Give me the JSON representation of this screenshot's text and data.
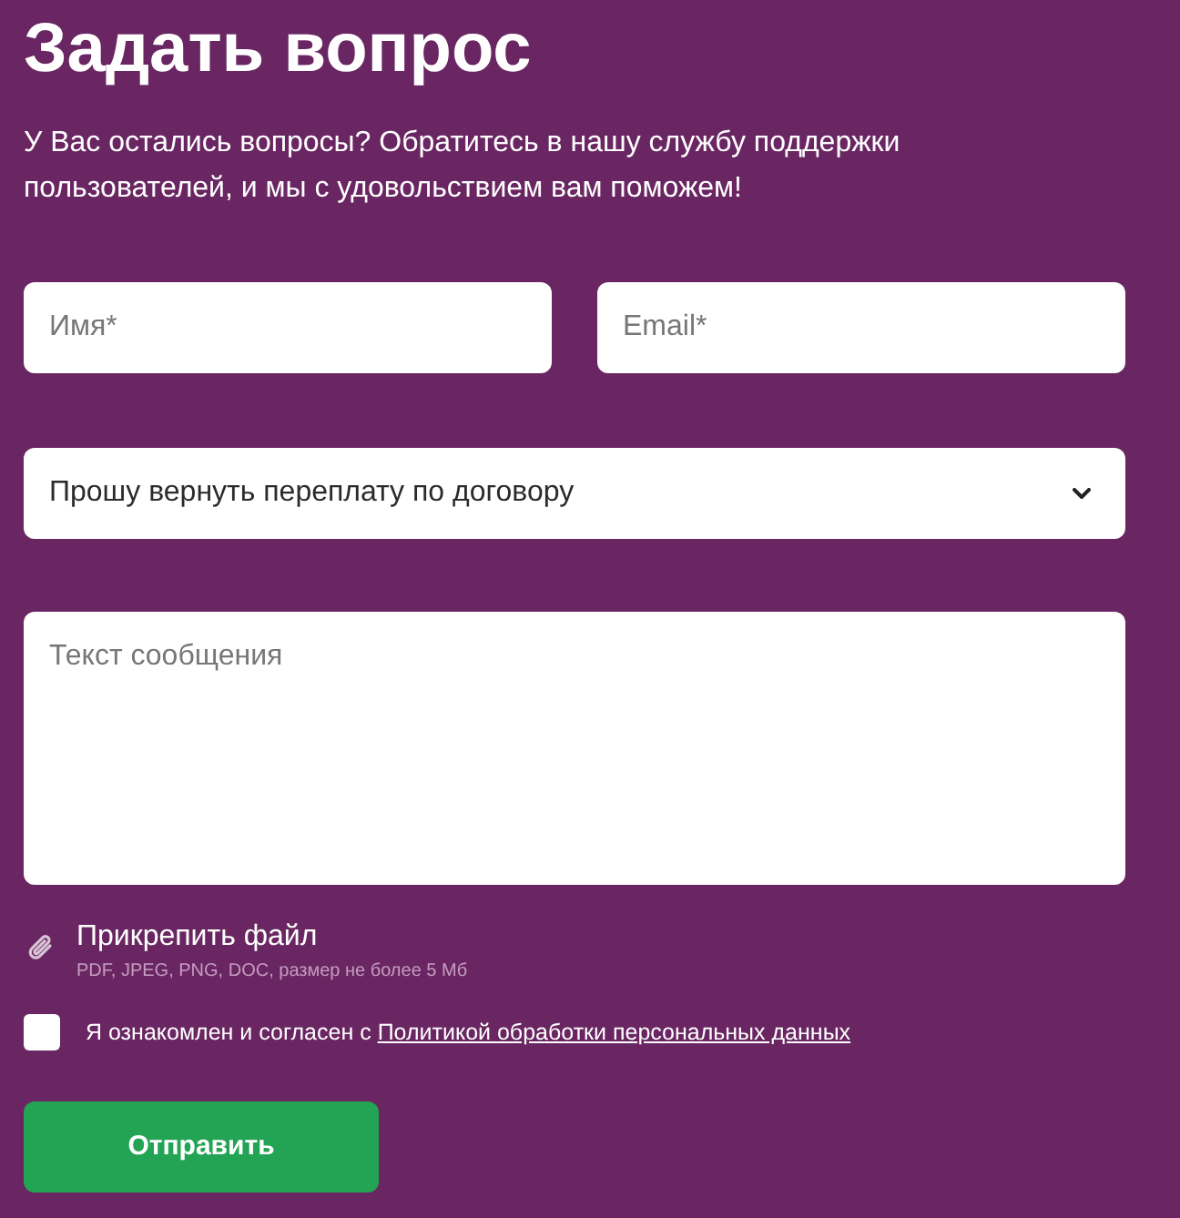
{
  "title": "Задать вопрос",
  "intro": "У Вас остались вопросы? Обратитесь в нашу службу поддержки пользователей, и мы с удовольствием вам поможем!",
  "fields": [
    {
      "kind": "input",
      "placeholder": "Имя*"
    },
    {
      "kind": "input",
      "placeholder": "Email*"
    }
  ],
  "select": {
    "value": "Прошу вернуть переплату по договору"
  },
  "message": {
    "placeholder": "Текст сообщения"
  },
  "attachment": {
    "label": "Прикрепить файл",
    "hint": "PDF, JPEG, PNG, DOC, размер не более 5 Мб"
  },
  "consent": {
    "checked": false,
    "text": "Я ознакомлен и согласен с ",
    "link": "Политикой обработки персональных данных"
  },
  "submit": {
    "label": "Отправить"
  }
}
